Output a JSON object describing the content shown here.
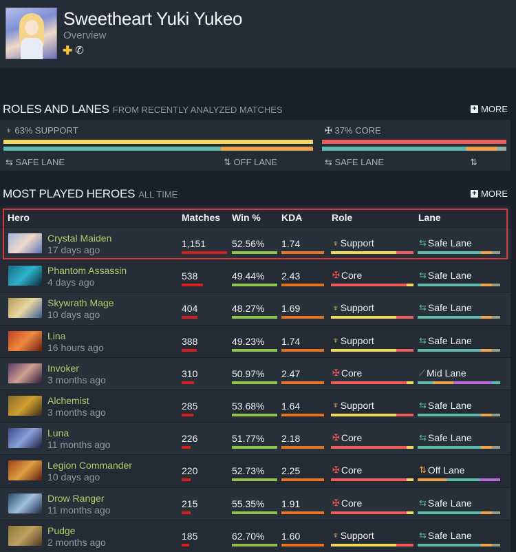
{
  "profile": {
    "name": "Sweetheart Yuki Yukeo",
    "subtitle": "Overview",
    "badges": [
      "plus-icon",
      "phone-icon"
    ]
  },
  "roles_section": {
    "title": "ROLES AND LANES",
    "subtitle": "FROM RECENTLY ANALYZED MATCHES",
    "more": "MORE",
    "support_label": "63% SUPPORT",
    "core_label": "37% CORE",
    "support_lane_left": "SAFE LANE",
    "support_lane_right": "OFF LANE",
    "core_lane_left": "SAFE LANE",
    "support_share": 0.63,
    "core_share": 0.37
  },
  "heroes_section": {
    "title": "MOST PLAYED HEROES",
    "subtitle": "ALL TIME",
    "more": "MORE",
    "columns": {
      "hero": "Hero",
      "matches": "Matches",
      "winrate": "Win %",
      "kda": "KDA",
      "role": "Role",
      "lane": "Lane"
    },
    "rows": [
      {
        "hero": "Crystal Maiden",
        "time": "17 days ago",
        "matches": "1,151",
        "winrate": "52.56%",
        "kda": "1.74",
        "role": "Support",
        "lane": "Safe Lane",
        "match_frac": 1.0,
        "win_frac": 0.5256
      },
      {
        "hero": "Phantom Assassin",
        "time": "4 days ago",
        "matches": "538",
        "winrate": "49.44%",
        "kda": "2.43",
        "role": "Core",
        "lane": "Safe Lane",
        "match_frac": 0.47,
        "win_frac": 0.4944
      },
      {
        "hero": "Skywrath Mage",
        "time": "10 days ago",
        "matches": "404",
        "winrate": "48.27%",
        "kda": "1.69",
        "role": "Support",
        "lane": "Safe Lane",
        "match_frac": 0.35,
        "win_frac": 0.4827
      },
      {
        "hero": "Lina",
        "time": "16 hours ago",
        "matches": "388",
        "winrate": "49.23%",
        "kda": "1.74",
        "role": "Support",
        "lane": "Safe Lane",
        "match_frac": 0.34,
        "win_frac": 0.4923
      },
      {
        "hero": "Invoker",
        "time": "3 months ago",
        "matches": "310",
        "winrate": "50.97%",
        "kda": "2.47",
        "role": "Core",
        "lane": "Mid Lane",
        "match_frac": 0.27,
        "win_frac": 0.5097
      },
      {
        "hero": "Alchemist",
        "time": "3 months ago",
        "matches": "285",
        "winrate": "53.68%",
        "kda": "1.64",
        "role": "Support",
        "lane": "Safe Lane",
        "match_frac": 0.25,
        "win_frac": 0.5368
      },
      {
        "hero": "Luna",
        "time": "11 months ago",
        "matches": "226",
        "winrate": "51.77%",
        "kda": "2.18",
        "role": "Core",
        "lane": "Safe Lane",
        "match_frac": 0.2,
        "win_frac": 0.5177
      },
      {
        "hero": "Legion Commander",
        "time": "10 days ago",
        "matches": "220",
        "winrate": "52.73%",
        "kda": "2.25",
        "role": "Core",
        "lane": "Off Lane",
        "match_frac": 0.19,
        "win_frac": 0.5273
      },
      {
        "hero": "Drow Ranger",
        "time": "11 months ago",
        "matches": "215",
        "winrate": "55.35%",
        "kda": "1.91",
        "role": "Core",
        "lane": "Safe Lane",
        "match_frac": 0.19,
        "win_frac": 0.5535
      },
      {
        "hero": "Pudge",
        "time": "2 months ago",
        "matches": "185",
        "winrate": "62.70%",
        "kda": "1.60",
        "role": "Support",
        "lane": "Safe Lane",
        "match_frac": 0.16,
        "win_frac": 0.627
      }
    ]
  },
  "colors": {
    "support": "#f2d95c",
    "core": "#f05b5b",
    "safe": "#5fb9ad",
    "off": "#f0a24a",
    "mid": "#b56ad8",
    "win": "#8fc44a",
    "kda": "#e8731f",
    "matches": "#d61f1f",
    "highlight": "#d53b3b"
  }
}
